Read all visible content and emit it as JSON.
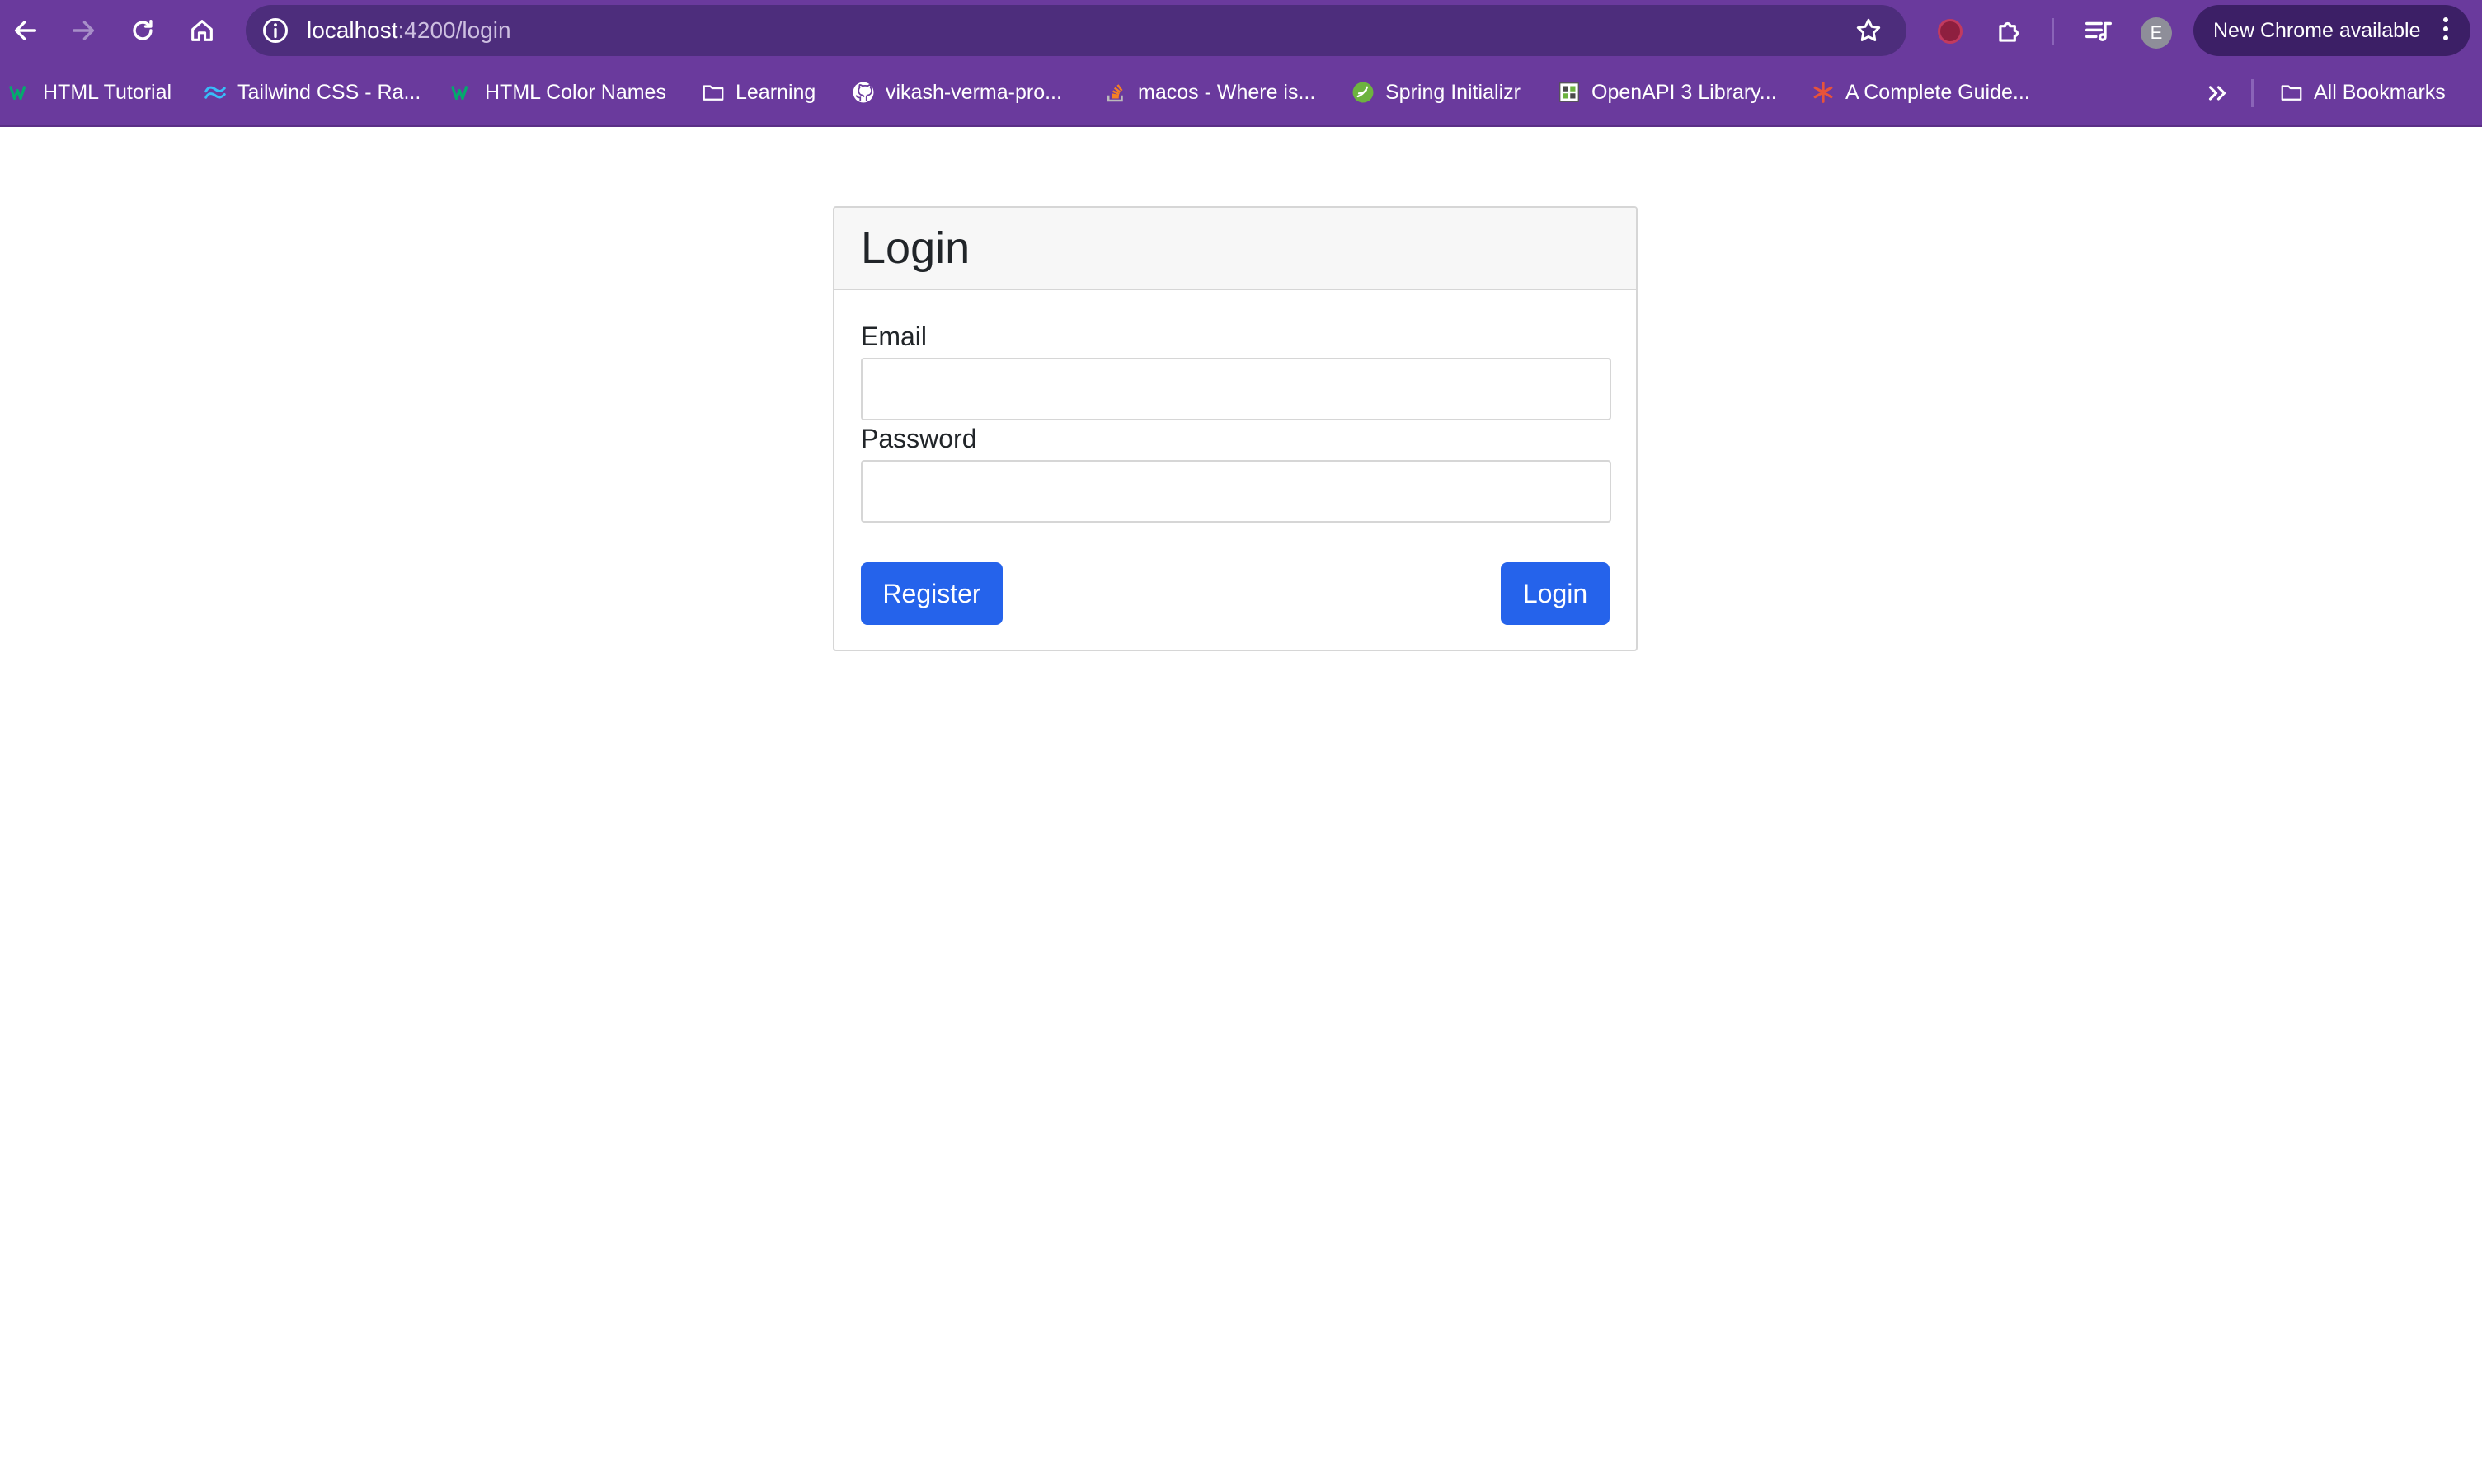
{
  "browser": {
    "url_host": "localhost",
    "url_path": ":4200/login",
    "profile_initial": "E",
    "update_label": "New Chrome available",
    "icons": [
      "back-arrow-icon",
      "forward-arrow-icon",
      "reload-icon",
      "home-icon",
      "site-info-icon",
      "bookmark-star-icon",
      "extensions-puzzle-icon",
      "reading-list-icon",
      "more-menu-icon"
    ]
  },
  "bookmarks": {
    "items": [
      {
        "label": "HTML Tutorial",
        "icon": "w3schools-icon"
      },
      {
        "label": "Tailwind CSS - Ra...",
        "icon": "tailwind-icon"
      },
      {
        "label": "HTML Color Names",
        "icon": "w3schools-icon"
      },
      {
        "label": "Learning",
        "icon": "folder-icon"
      },
      {
        "label": "vikash-verma-pro...",
        "icon": "github-icon"
      },
      {
        "label": "macos - Where is...",
        "icon": "stackoverflow-icon"
      },
      {
        "label": "Spring Initializr",
        "icon": "spring-icon"
      },
      {
        "label": "OpenAPI 3 Library...",
        "icon": "openapi-icon"
      },
      {
        "label": "A Complete Guide...",
        "icon": "asterisk-icon"
      }
    ],
    "all_bookmarks_label": "All Bookmarks"
  },
  "login_card": {
    "title": "Login",
    "email_label": "Email",
    "email_value": "",
    "password_label": "Password",
    "password_value": "",
    "register_button": "Register",
    "login_button": "Login"
  },
  "colors": {
    "browser_chrome": "#6a3a9d",
    "omnibox": "#4d2d7c",
    "primary_button": "#2563eb",
    "card_header": "#f7f7f7"
  }
}
